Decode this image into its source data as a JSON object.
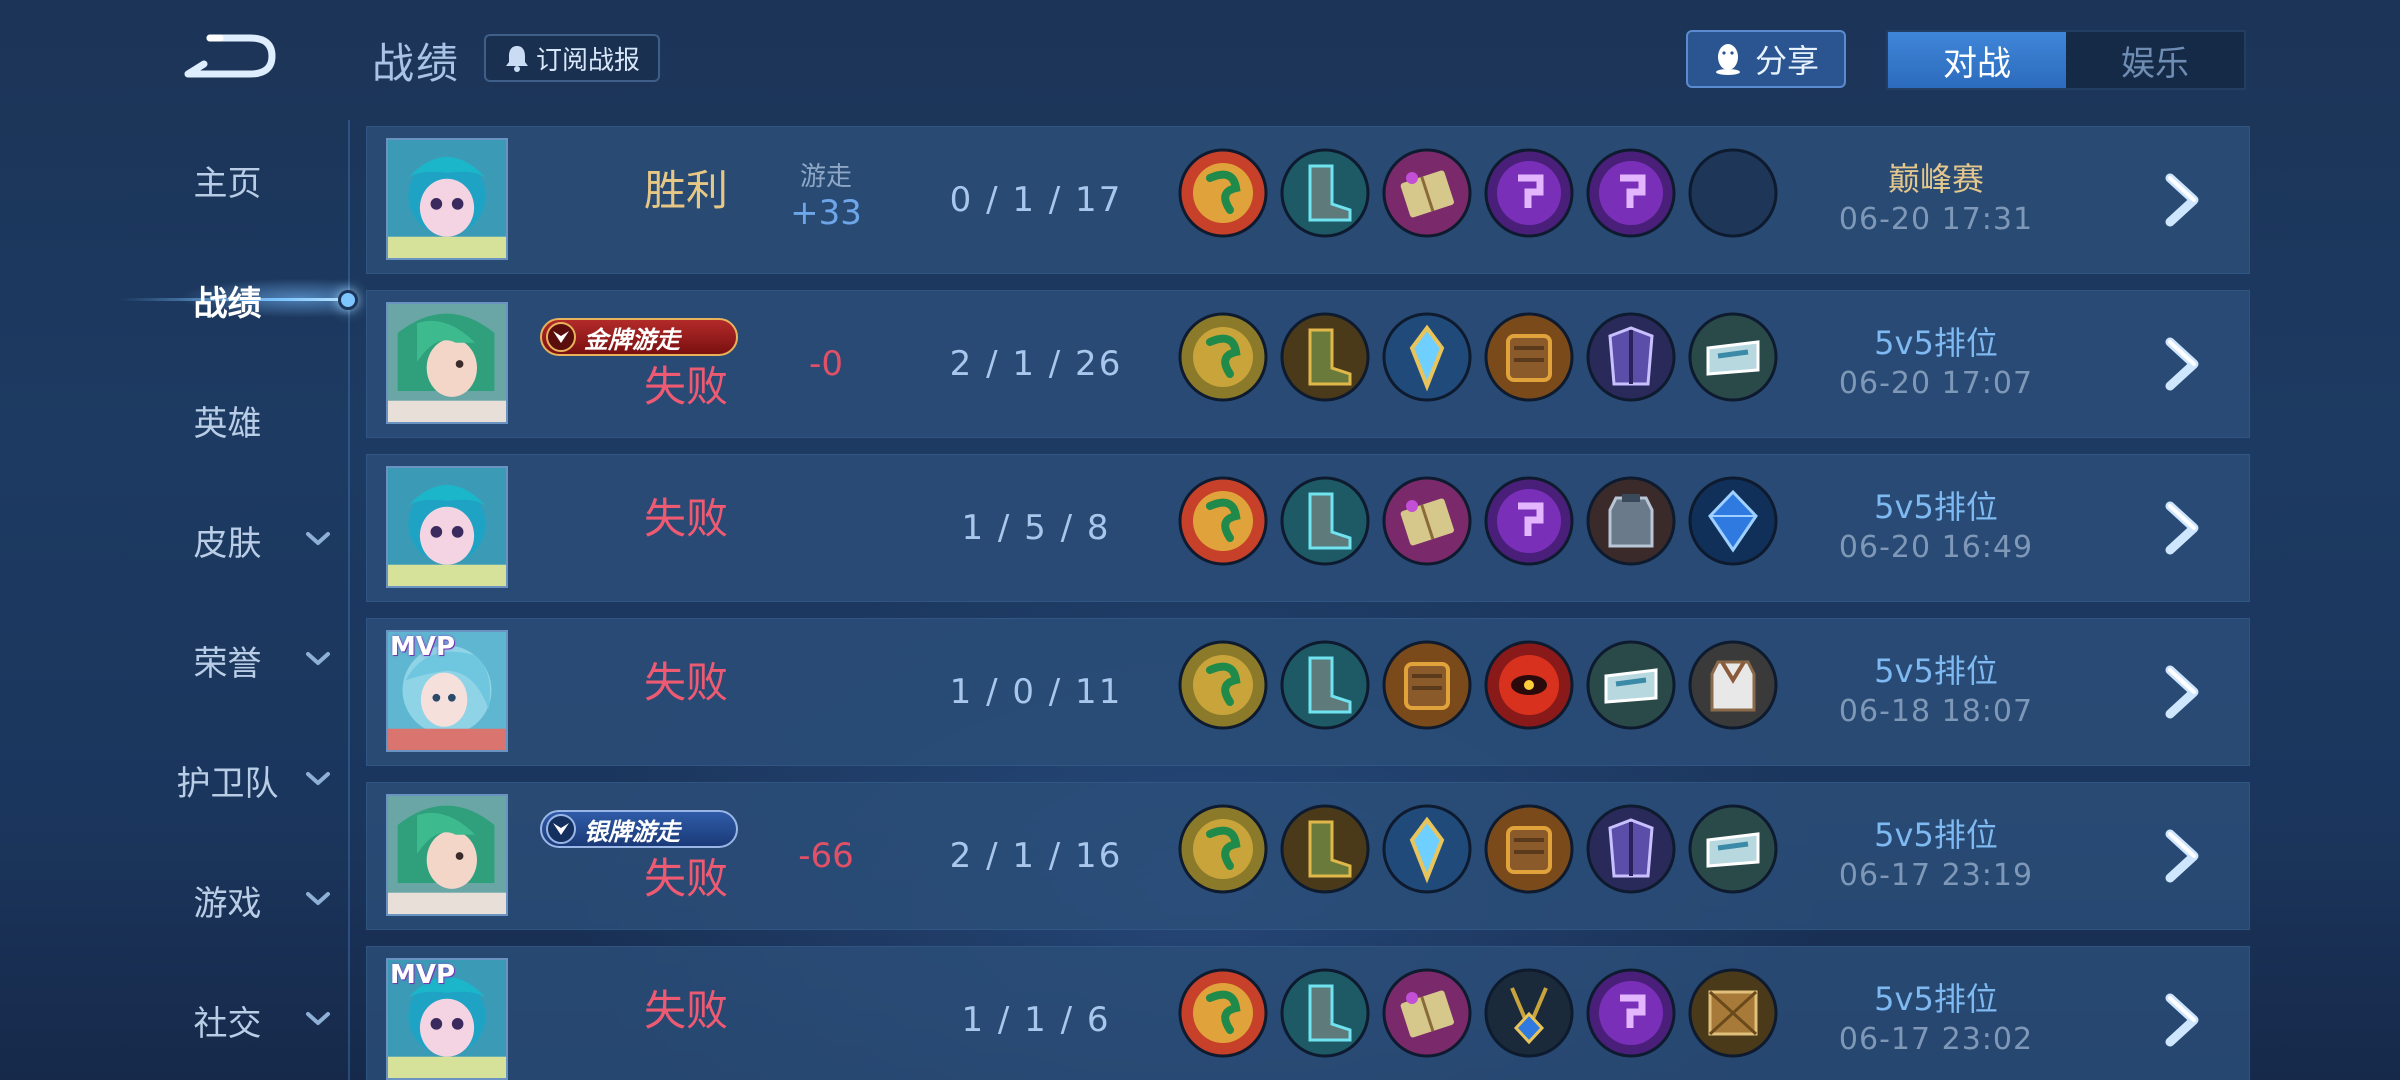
{
  "header": {
    "title": "战绩",
    "subscribe_label": "订阅战报",
    "share_label": "分享",
    "modes": [
      {
        "label": "对战",
        "active": true
      },
      {
        "label": "娱乐",
        "active": false
      }
    ]
  },
  "sidebar": {
    "items": [
      {
        "label": "主页",
        "has_chevron": false,
        "active": false
      },
      {
        "label": "战绩",
        "has_chevron": false,
        "active": true
      },
      {
        "label": "英雄",
        "has_chevron": false,
        "active": false
      },
      {
        "label": "皮肤",
        "has_chevron": true,
        "active": false
      },
      {
        "label": "荣誉",
        "has_chevron": true,
        "active": false
      },
      {
        "label": "护卫队",
        "has_chevron": true,
        "active": false
      },
      {
        "label": "游戏",
        "has_chevron": true,
        "active": false
      },
      {
        "label": "社交",
        "has_chevron": true,
        "active": false
      }
    ]
  },
  "matches": [
    {
      "hero": "blue-hair-hero",
      "mvp": false,
      "badge": "",
      "badge_type": "",
      "result": "胜利",
      "outcome": "win",
      "role": "游走",
      "points": "+33",
      "kda": "0 / 1 / 17",
      "items": [
        "snake-talisman-red",
        "boots-teal",
        "spellbook-pink",
        "purple-rune",
        "purple-rune",
        "empty-slot"
      ],
      "mode": "巅峰赛",
      "date": "06-20  17:31"
    },
    {
      "hero": "green-hair-hero",
      "mvp": false,
      "badge": "金牌游走",
      "badge_type": "gold",
      "result": "失败",
      "outcome": "lose",
      "role": "",
      "points": "-0",
      "kda": "2 / 1 / 26",
      "items": [
        "snake-talisman-gold",
        "boots-gold",
        "crystal-staff",
        "gauntlet-brown",
        "armor-purple",
        "shield-silver"
      ],
      "mode": "5v5排位",
      "date": "06-20  17:07"
    },
    {
      "hero": "blue-hair-hero",
      "mvp": false,
      "badge": "",
      "badge_type": "",
      "result": "失败",
      "outcome": "lose",
      "role": "",
      "points": "",
      "kda": "1 / 5 / 8",
      "items": [
        "snake-talisman-red",
        "boots-teal",
        "spellbook-pink",
        "purple-rune",
        "vest-grey",
        "blue-gem"
      ],
      "mode": "5v5排位",
      "date": "06-20  16:49"
    },
    {
      "hero": "aqua-hair-hero",
      "mvp": true,
      "badge": "",
      "badge_type": "",
      "result": "失败",
      "outcome": "lose",
      "role": "",
      "points": "",
      "kda": "1 / 0 / 11",
      "items": [
        "snake-talisman-gold",
        "boots-teal",
        "gauntlet-brown",
        "red-eye-orb",
        "shield-silver",
        "vest-white"
      ],
      "mode": "5v5排位",
      "date": "06-18  18:07"
    },
    {
      "hero": "green-hair-hero",
      "mvp": false,
      "badge": "银牌游走",
      "badge_type": "silver",
      "result": "失败",
      "outcome": "lose",
      "role": "",
      "points": "-66",
      "kda": "2 / 1 / 16",
      "items": [
        "snake-talisman-gold",
        "boots-gold",
        "crystal-staff",
        "gauntlet-brown",
        "armor-purple",
        "shield-silver"
      ],
      "mode": "5v5排位",
      "date": "06-17  23:19"
    },
    {
      "hero": "blue-hair-hero",
      "mvp": true,
      "badge": "",
      "badge_type": "",
      "result": "失败",
      "outcome": "lose",
      "role": "",
      "points": "",
      "kda": "1 / 1 / 6",
      "items": [
        "snake-talisman-red",
        "boots-teal",
        "spellbook-pink",
        "pendant-blue",
        "purple-rune",
        "wooden-crate"
      ],
      "mode": "5v5排位",
      "date": "06-17  23:02"
    }
  ],
  "colors": {
    "win": "#e7c784",
    "lose": "#ef5a73",
    "accent": "#3f86d8",
    "points_positive": "#6ea6ea",
    "points_negative": "#e25068"
  }
}
